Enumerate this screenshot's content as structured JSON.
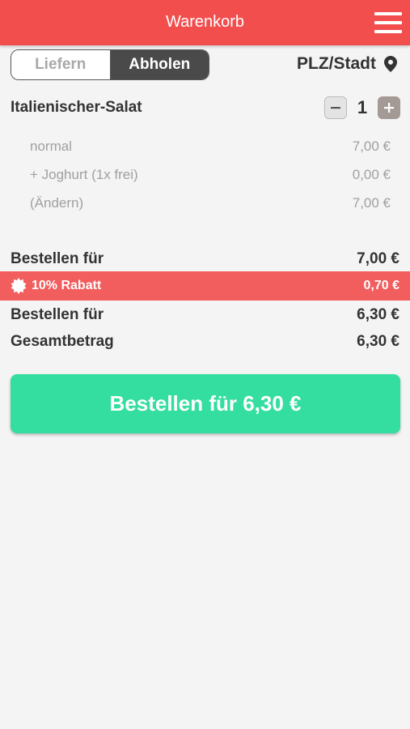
{
  "header": {
    "title": "Warenkorb",
    "menu_icon": "hamburger-menu-icon"
  },
  "delivery_toggle": {
    "options": [
      "Liefern",
      "Abholen"
    ],
    "selected": "Abholen"
  },
  "location": {
    "label": "PLZ/Stadt",
    "icon": "location-pin-icon"
  },
  "cart": {
    "item_name": "Italienischer-Salat",
    "quantity": "1",
    "details": [
      {
        "label": "normal",
        "price": "7,00 €"
      },
      {
        "label": "+ Joghurt (1x frei)",
        "price": "0,00 €"
      },
      {
        "label": "(Ändern)",
        "price": "7,00 €"
      }
    ]
  },
  "summary": {
    "subtotal_label": "Bestellen für",
    "subtotal_value": "7,00 €",
    "discount_label": "10% Rabatt",
    "discount_value": "0,70 €",
    "after_discount_label": "Bestellen für",
    "after_discount_value": "6,30 €",
    "total_label": "Gesamtbetrag",
    "total_value": "6,30 €"
  },
  "order_button": {
    "label": "Bestellen für 6,30 €"
  },
  "colors": {
    "header": "#f24e4e",
    "discount": "#f25d5d",
    "button": "#34dea0"
  }
}
